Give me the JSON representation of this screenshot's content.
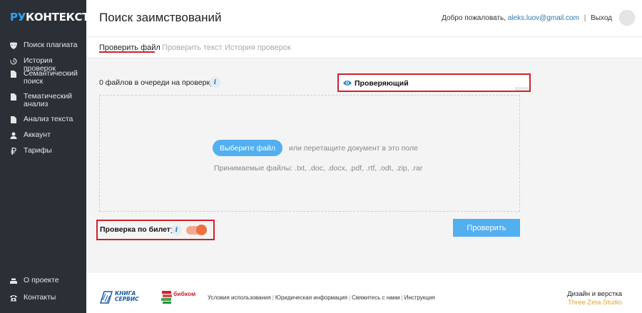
{
  "brand": {
    "logo_accent": "РУ",
    "logo_main": "КОНТЕКСТ",
    "accent_color": "#2ea3f2"
  },
  "sidebar": {
    "items": [
      {
        "label": "Поиск плагиата",
        "icon": "mask-icon"
      },
      {
        "label": "История проверок",
        "icon": "history-icon"
      },
      {
        "label": "Семантический поиск",
        "icon": "semantic-search-icon"
      },
      {
        "label": "Тематический анализ",
        "icon": "thematic-icon"
      },
      {
        "label": "Анализ текста",
        "icon": "text-analysis-icon"
      },
      {
        "label": "Аккаунт",
        "icon": "user-icon"
      },
      {
        "label": "Тарифы",
        "icon": "ruble-icon"
      }
    ],
    "bottom": [
      {
        "label": "О проекте",
        "icon": "about-icon"
      },
      {
        "label": "Контакты",
        "icon": "phone-icon"
      }
    ]
  },
  "header": {
    "title": "Поиск заимствований",
    "welcome": "Добро пожаловать,",
    "email": "aleks.luov@gmail.com",
    "separator": "|",
    "logout": "Выход"
  },
  "tabs": [
    {
      "label": "Проверить файл",
      "active": true
    },
    {
      "label": "Проверить текст",
      "active": false
    },
    {
      "label": "История проверок",
      "active": false
    }
  ],
  "main": {
    "queue_text": "0 файлов в очереди на проверку",
    "info_glyph": "i",
    "reviewer_label": "Проверяющий",
    "choose_file": "Выберите файл",
    "drop_hint": "или перетащите документ в это поле",
    "accepted_files": "Принимаемые файлы: .txt, .doc, .docx, .pdf, .rtf, .odt, .zip, .rar",
    "ticket_label": "Проверка по билету",
    "ticket_enabled": true,
    "check_button": "Проверить",
    "highlight_color": "#d0212a",
    "button_color": "#52aff0",
    "toggle_color": "#ee6f3f"
  },
  "footer": {
    "logo1_line1": "КНИГА",
    "logo1_line2": "СЕРВИС",
    "logo2": "бибком",
    "links": [
      "Условия использования",
      "Юридическая информация",
      "Свяжитесь с нами",
      "Инструкция"
    ],
    "link_separator": "|",
    "credit_line": "Дизайн и верстка",
    "studio": "Three Zeta Studio"
  }
}
